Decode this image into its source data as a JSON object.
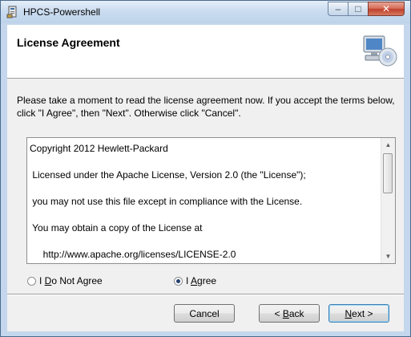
{
  "window": {
    "title": "HPCS-Powershell",
    "minimize_label": "–",
    "maximize_label": "□",
    "close_label": "✕"
  },
  "header": {
    "title": "License Agreement",
    "icon": "computer-cd-icon"
  },
  "instructions": "Please take a moment to read the license agreement now. If you accept the terms below, click \"I Agree\", then \"Next\". Otherwise click \"Cancel\".",
  "license": {
    "lines": [
      "Copyright 2012 Hewlett-Packard",
      " Licensed under the Apache License, Version 2.0 (the \"License\");",
      " you may not use this file except in compliance with the License.",
      " You may obtain a copy of the License at",
      "     http://www.apache.org/licenses/LICENSE-2.0"
    ]
  },
  "options": {
    "disagree": {
      "pre": "I ",
      "key": "D",
      "post": "o Not Agree",
      "selected": false
    },
    "agree": {
      "pre": "I ",
      "key": "A",
      "post": "gree",
      "selected": true
    }
  },
  "buttons": {
    "cancel": "Cancel",
    "back_pre": "< ",
    "back_key": "B",
    "back_post": "ack",
    "next_key": "N",
    "next_post": "ext >"
  }
}
